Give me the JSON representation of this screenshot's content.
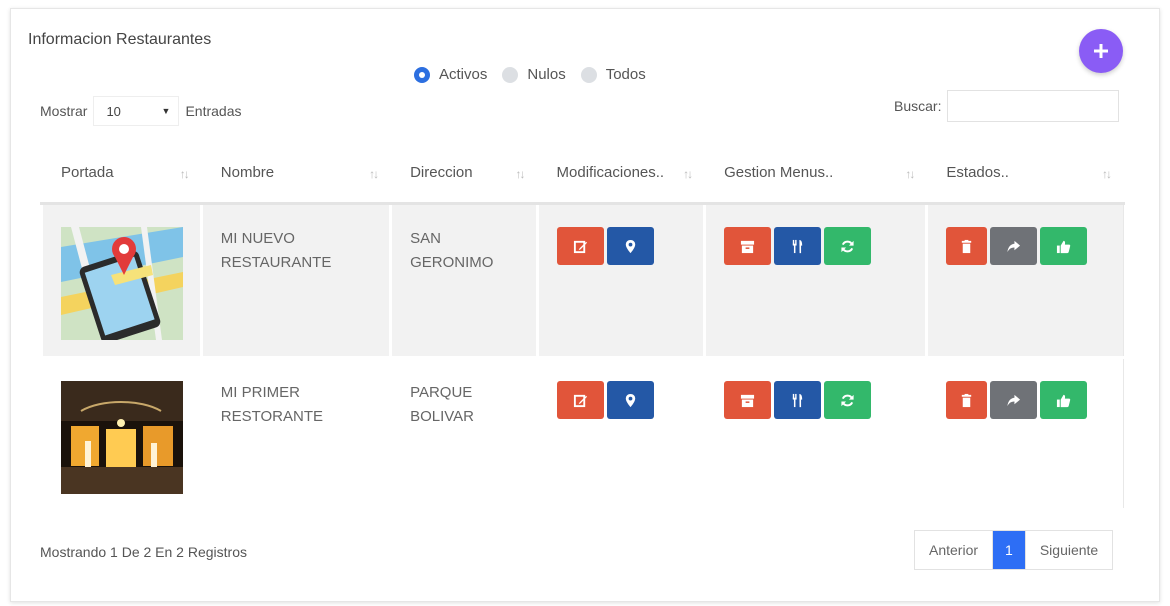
{
  "title": "Informacion Restaurantes",
  "filters": [
    {
      "label": "Activos",
      "checked": true
    },
    {
      "label": "Nulos",
      "checked": false
    },
    {
      "label": "Todos",
      "checked": false
    }
  ],
  "length": {
    "prefix": "Mostrar",
    "value": "10",
    "suffix": "Entradas"
  },
  "search": {
    "label": "Buscar:",
    "value": ""
  },
  "columns": [
    "Portada",
    "Nombre",
    "Direccion",
    "Modificaciones..",
    "Gestion Menus..",
    "Estados.."
  ],
  "rows": [
    {
      "nombre_1": "MI NUEVO",
      "nombre_2": "RESTAURANTE",
      "direccion_1": "SAN",
      "direccion_2": "GERONIMO"
    },
    {
      "nombre_1": "MI PRIMER",
      "nombre_2": "RESTORANTE",
      "direccion_1": "PARQUE",
      "direccion_2": "BOLIVAR"
    }
  ],
  "footer": {
    "info": "Mostrando 1 De 2 En 2 Registros"
  },
  "pagination": {
    "prev": "Anterior",
    "current": "1",
    "next": "Siguiente"
  },
  "colors": {
    "orange": "#e1553a",
    "blue": "#2458a6",
    "green": "#33b86b",
    "gray": "#6f7277",
    "accent": "#8a5cf5",
    "page_active": "#2d6ef5"
  },
  "icons": {
    "add": "plus-icon",
    "modificaciones": [
      "edit-icon",
      "map-marker-icon"
    ],
    "gestion_menus": [
      "archive-icon",
      "cutlery-icon",
      "refresh-icon"
    ],
    "estados": [
      "trash-icon",
      "share-icon",
      "thumbs-up-icon"
    ]
  }
}
